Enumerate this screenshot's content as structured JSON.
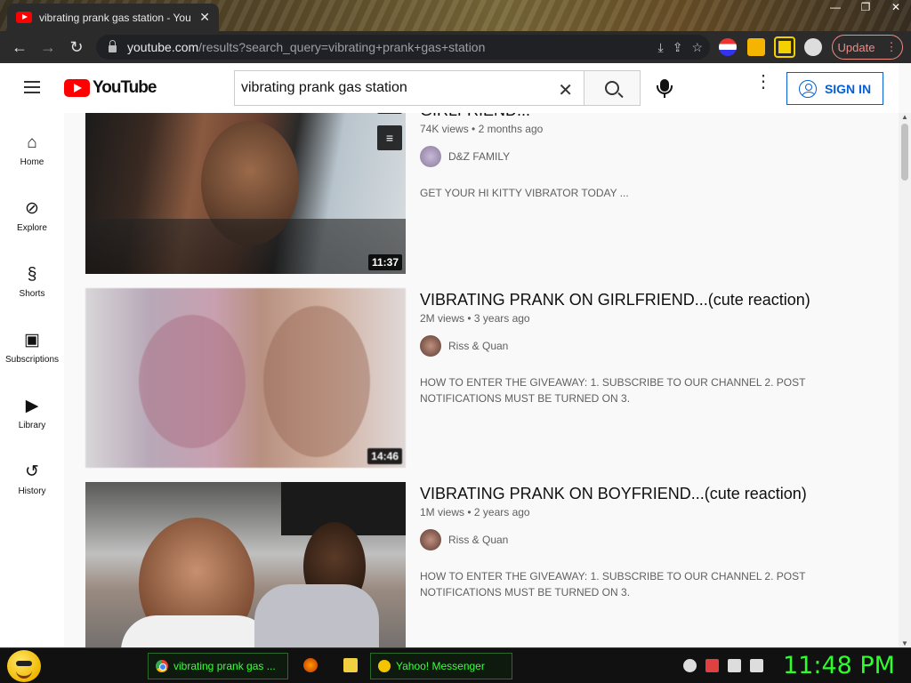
{
  "browser": {
    "tab_title": "vibrating prank gas station - You",
    "tab_close": "✕",
    "window_controls": [
      "—",
      "❐",
      "✕"
    ],
    "url_host": "youtube.com",
    "url_path": "/results?search_query=vibrating+prank+gas+station",
    "update_label": "Update",
    "update_menu": "⋮"
  },
  "youtube": {
    "logo_text": "YouTube",
    "search_value": "vibrating prank gas station",
    "search_clear": "✕",
    "menu_glyph": "⋮",
    "signin_label": "SIGN IN"
  },
  "guide": [
    {
      "label": "Home",
      "icon": "home-icon",
      "glyph": "⌂"
    },
    {
      "label": "Explore",
      "icon": "compass-icon",
      "glyph": "⊘"
    },
    {
      "label": "Shorts",
      "icon": "shorts-icon",
      "glyph": "§"
    },
    {
      "label": "Subscriptions",
      "icon": "subscriptions-icon",
      "glyph": "▣"
    },
    {
      "label": "Library",
      "icon": "library-icon",
      "glyph": "▶"
    },
    {
      "label": "History",
      "icon": "history-icon",
      "glyph": "↺"
    }
  ],
  "results": [
    {
      "title": "GIRLFRIEND...",
      "views": "74K views",
      "age": "2 months ago",
      "channel": "D&Z FAMILY",
      "description": "GET YOUR HI KITTY VIBRATOR TODAY  ...",
      "duration": "11:37"
    },
    {
      "title": "VIBRATING PRANK ON GIRLFRIEND...(cute reaction)",
      "views": "2M views",
      "age": "3 years ago",
      "channel": "Riss & Quan",
      "description": "HOW TO ENTER THE GIVEAWAY: 1. SUBSCRIBE TO OUR CHANNEL 2. POST NOTIFICATIONS MUST BE TURNED ON 3.",
      "duration": "14:46"
    },
    {
      "title": "VIBRATING PRANK ON BOYFRIEND...(cute reaction)",
      "views": "1M views",
      "age": "2 years ago",
      "channel": "Riss & Quan",
      "description": "HOW TO ENTER THE GIVEAWAY: 1. SUBSCRIBE TO OUR CHANNEL 2. POST NOTIFICATIONS MUST BE TURNED ON 3.",
      "duration": ""
    }
  ],
  "taskbar": {
    "chrome_task": "vibrating prank gas ...",
    "yahoo_task": "Yahoo! Messenger",
    "clock": "11:48 PM"
  },
  "colors": {
    "youtube_red": "#ff0000",
    "signin_blue": "#065fd4",
    "taskbar_green": "#3cff3c"
  }
}
